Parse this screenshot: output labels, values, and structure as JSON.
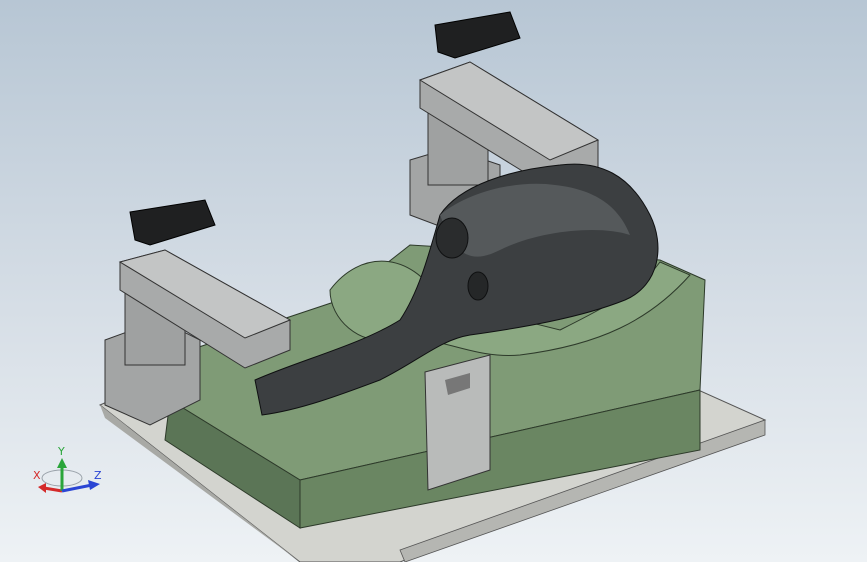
{
  "view": {
    "background": {
      "top": "#b7c6d4",
      "bottom": "#eef2f5"
    }
  },
  "colors": {
    "base_plate": "#c9cbc6",
    "fixture_green": "#6f8a67",
    "fixture_green_dark": "#50664c",
    "metal_grey": "#a9abab",
    "part_dark": "#3b3e40",
    "clamp_black": "#1e1f20"
  },
  "triad": {
    "x_label": "X",
    "y_label": "Y",
    "z_label": "Z",
    "x_color": "#d42a2a",
    "y_color": "#2aa53a",
    "z_color": "#2a45d4"
  }
}
